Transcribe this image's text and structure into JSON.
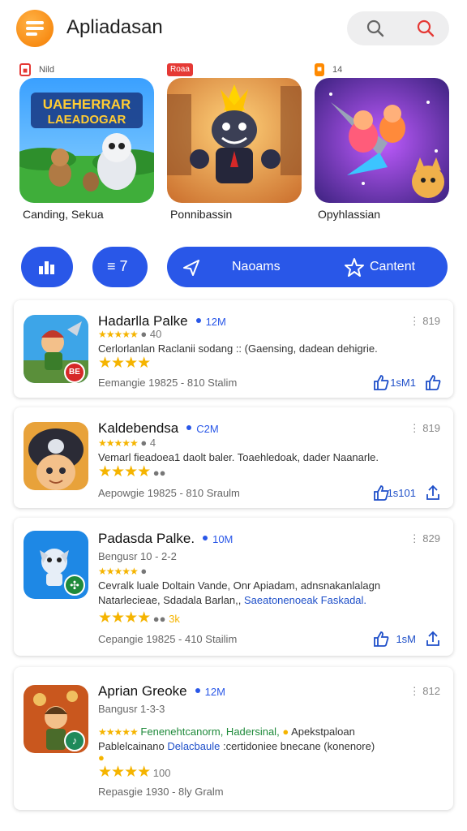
{
  "app": {
    "title": "Apliadasan"
  },
  "colors": {
    "accent": "#2957e8",
    "brand": "#f57c00",
    "star": "#f5b400"
  },
  "header": {
    "search_icon": "search-icon",
    "search_icon_alt": "search-icon-red"
  },
  "featured": [
    {
      "badge": "■",
      "badge_text": "Nild",
      "art_title_line1": "UAEHERRAR",
      "art_title_line2": "LAEADOGAR",
      "caption": "Canding, Sekua"
    },
    {
      "badge": "Roaa",
      "badge_text": "",
      "caption": "Ponnibassin"
    },
    {
      "badge": "■",
      "badge_text": "14",
      "caption": "Opyhlassian"
    }
  ],
  "filters": {
    "btn1_icon": "chart-icon",
    "btn2_icon": "filter-icon",
    "btn2_label": "≡ 7",
    "pill_left_label": "Naoams",
    "pill_right_label": "Cantent"
  },
  "cards": [
    {
      "name": "Hadarlla Palke",
      "size": "12M",
      "menu": "⋮ 819",
      "rating_text": "40",
      "desc": "Cerlorlanlan Raclanii sodang :: (Gaensing, dadean dehigrie.",
      "badge": "BE",
      "footer": "Eemangie 19825 - 810  Stalim",
      "likes": "1sM1"
    },
    {
      "name": "Kaldebendsa",
      "size": "C2M",
      "menu": "⋮ 819",
      "rating_text": "4",
      "desc": "Vemarl fieadoea1 daolt baler.  Toaehledoak, dader Naanarle.",
      "badge": "",
      "footer": "Aepowgie 19825 - 810  Sraulm",
      "likes": "1s101"
    },
    {
      "name": "Padasda Palke.",
      "size": "10M",
      "menu": "⋮ 829",
      "rating_prefix": "Bengusr 10 - 2-2",
      "desc": "Cevralk luale  Doltain  Vande,  Onr  Apiadam,  adnsnakanlalagn",
      "desc2_a": "Natarlecieae, Sdadala Barlan,,",
      "desc2_b": "Saeatonenoeak Faskadal.",
      "stars_extra": "3k",
      "footer": "Cepangie 19825 - 410  Stailim",
      "likes": "1sM"
    },
    {
      "name": "Aprian Greoke",
      "size": "12M",
      "menu": "⋮ 812",
      "rating_prefix": "Bangusr 1-3-3",
      "line_green": "Fenenehtcanorm, Hadersinal,",
      "line_after": "Apekstpaloan",
      "desc2_a": "Pablelcainano",
      "desc2_b": "Delacbaule",
      "desc2_c": ":certidoniee bnecane (konenore)",
      "stars_extra": "100",
      "footer": "Repasgie 1930 - 8ly  Gralm",
      "likes": ""
    }
  ]
}
